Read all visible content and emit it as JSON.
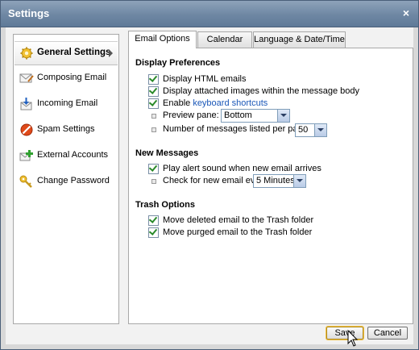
{
  "dialog": {
    "title": "Settings",
    "close_glyph": "×"
  },
  "nav": {
    "items": [
      {
        "label": "General Settings",
        "icon": "gear-icon",
        "active": true
      },
      {
        "label": "Composing Email",
        "icon": "compose-email-icon",
        "active": false
      },
      {
        "label": "Incoming Email",
        "icon": "incoming-email-icon",
        "active": false
      },
      {
        "label": "Spam Settings",
        "icon": "no-entry-icon",
        "active": false
      },
      {
        "label": "External Accounts",
        "icon": "add-accounts-icon",
        "active": false
      },
      {
        "label": "Change Password",
        "icon": "key-icon",
        "active": false
      }
    ]
  },
  "tabs": [
    {
      "label": "Email Options",
      "active": true
    },
    {
      "label": "Calendar",
      "active": false
    },
    {
      "label": "Language & Date/Time",
      "active": false
    }
  ],
  "display": {
    "heading": "Display Preferences",
    "html_emails": {
      "label": "Display HTML emails",
      "checked": true
    },
    "attached_images": {
      "label": "Display attached images within the message body",
      "checked": true
    },
    "shortcuts": {
      "prefix": "Enable ",
      "link": "keyboard shortcuts",
      "checked": true
    },
    "preview_pane": {
      "label": "Preview pane:",
      "value": "Bottom"
    },
    "messages_per_page": {
      "label": "Number of messages listed per page:",
      "value": "50"
    }
  },
  "new_messages": {
    "heading": "New Messages",
    "alert_sound": {
      "label": "Play alert sound when new email arrives",
      "checked": true
    },
    "check_every": {
      "label": "Check for new email every:",
      "value": "5 Minutes"
    }
  },
  "trash": {
    "heading": "Trash Options",
    "move_deleted": {
      "label": "Move deleted email to the Trash folder",
      "checked": true
    },
    "move_purged": {
      "label": "Move purged email to the Trash folder",
      "checked": true
    }
  },
  "buttons": {
    "save": "Save",
    "cancel": "Cancel"
  },
  "colors": {
    "titlebar": "#6e87a3",
    "link": "#1a57b8",
    "checkmark": "#2a8a2a"
  }
}
